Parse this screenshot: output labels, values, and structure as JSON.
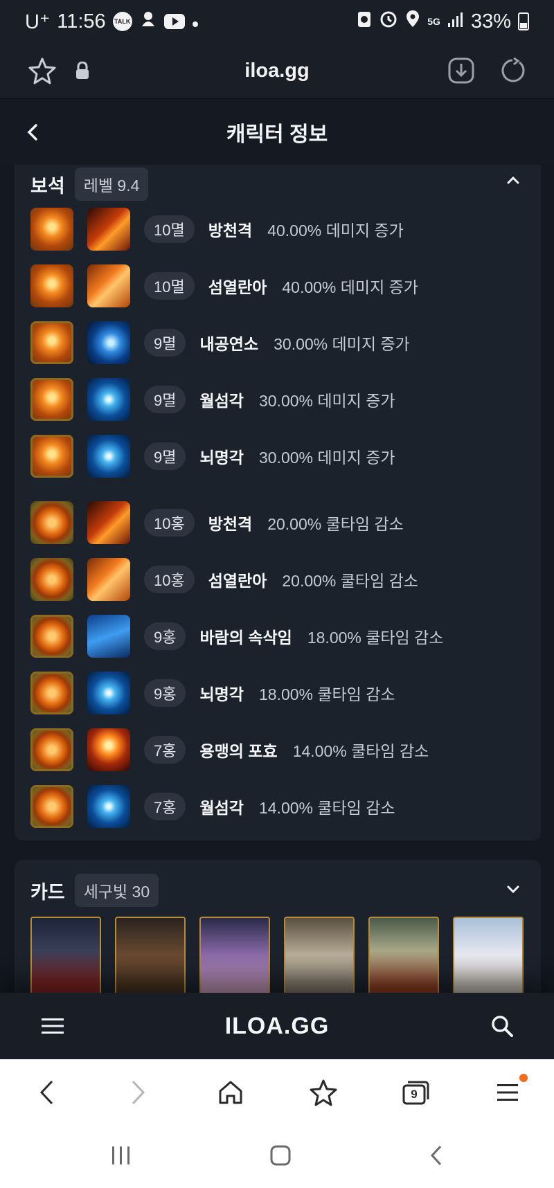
{
  "status_bar": {
    "carrier": "U⁺",
    "time": "11:56",
    "talk_badge": "TALK",
    "network": "5G",
    "battery": "33%"
  },
  "browser": {
    "url": "iloa.gg"
  },
  "page": {
    "title": "캐릭터 정보"
  },
  "gems": {
    "title": "보석",
    "badge": "레벨 9.4",
    "rows": [
      {
        "level": "10멸",
        "skill": "방천격",
        "effect": "40.00% 데미지 증가",
        "gem": "dmg",
        "icon": "sk-red"
      },
      {
        "level": "10멸",
        "skill": "섬열란아",
        "effect": "40.00% 데미지 증가",
        "gem": "dmg",
        "icon": "sk-orange"
      },
      {
        "level": "9멸",
        "skill": "내공연소",
        "effect": "30.00% 데미지 증가",
        "gem": "dmg-gold",
        "icon": "sk-blue"
      },
      {
        "level": "9멸",
        "skill": "월섬각",
        "effect": "30.00% 데미지 증가",
        "gem": "dmg-gold",
        "icon": "sk-bluebolt"
      },
      {
        "level": "9멸",
        "skill": "뇌명각",
        "effect": "30.00% 데미지 증가",
        "gem": "dmg-gold",
        "icon": "sk-bluebolt"
      },
      {
        "level": "10홍",
        "skill": "방천격",
        "effect": "20.00% 쿨타임 감소",
        "gem": "cd",
        "icon": "sk-red"
      },
      {
        "level": "10홍",
        "skill": "섬열란아",
        "effect": "20.00% 쿨타임 감소",
        "gem": "cd",
        "icon": "sk-orange"
      },
      {
        "level": "9홍",
        "skill": "바람의 속삭임",
        "effect": "18.00% 쿨타임 감소",
        "gem": "cd-gold",
        "icon": "sk-run"
      },
      {
        "level": "9홍",
        "skill": "뇌명각",
        "effect": "18.00% 쿨타임 감소",
        "gem": "cd-gold",
        "icon": "sk-bluebolt"
      },
      {
        "level": "7홍",
        "skill": "용맹의 포효",
        "effect": "14.00% 쿨타임 감소",
        "gem": "cd-gold",
        "icon": "sk-fire"
      },
      {
        "level": "7홍",
        "skill": "월섬각",
        "effect": "14.00% 쿨타임 감소",
        "gem": "cd-gold",
        "icon": "sk-bluebolt"
      }
    ]
  },
  "cards": {
    "title": "카드",
    "badge": "세구빛 30"
  },
  "site_nav": {
    "logo": "ILOA.GG"
  },
  "browser_nav": {
    "tab_count": "9"
  }
}
